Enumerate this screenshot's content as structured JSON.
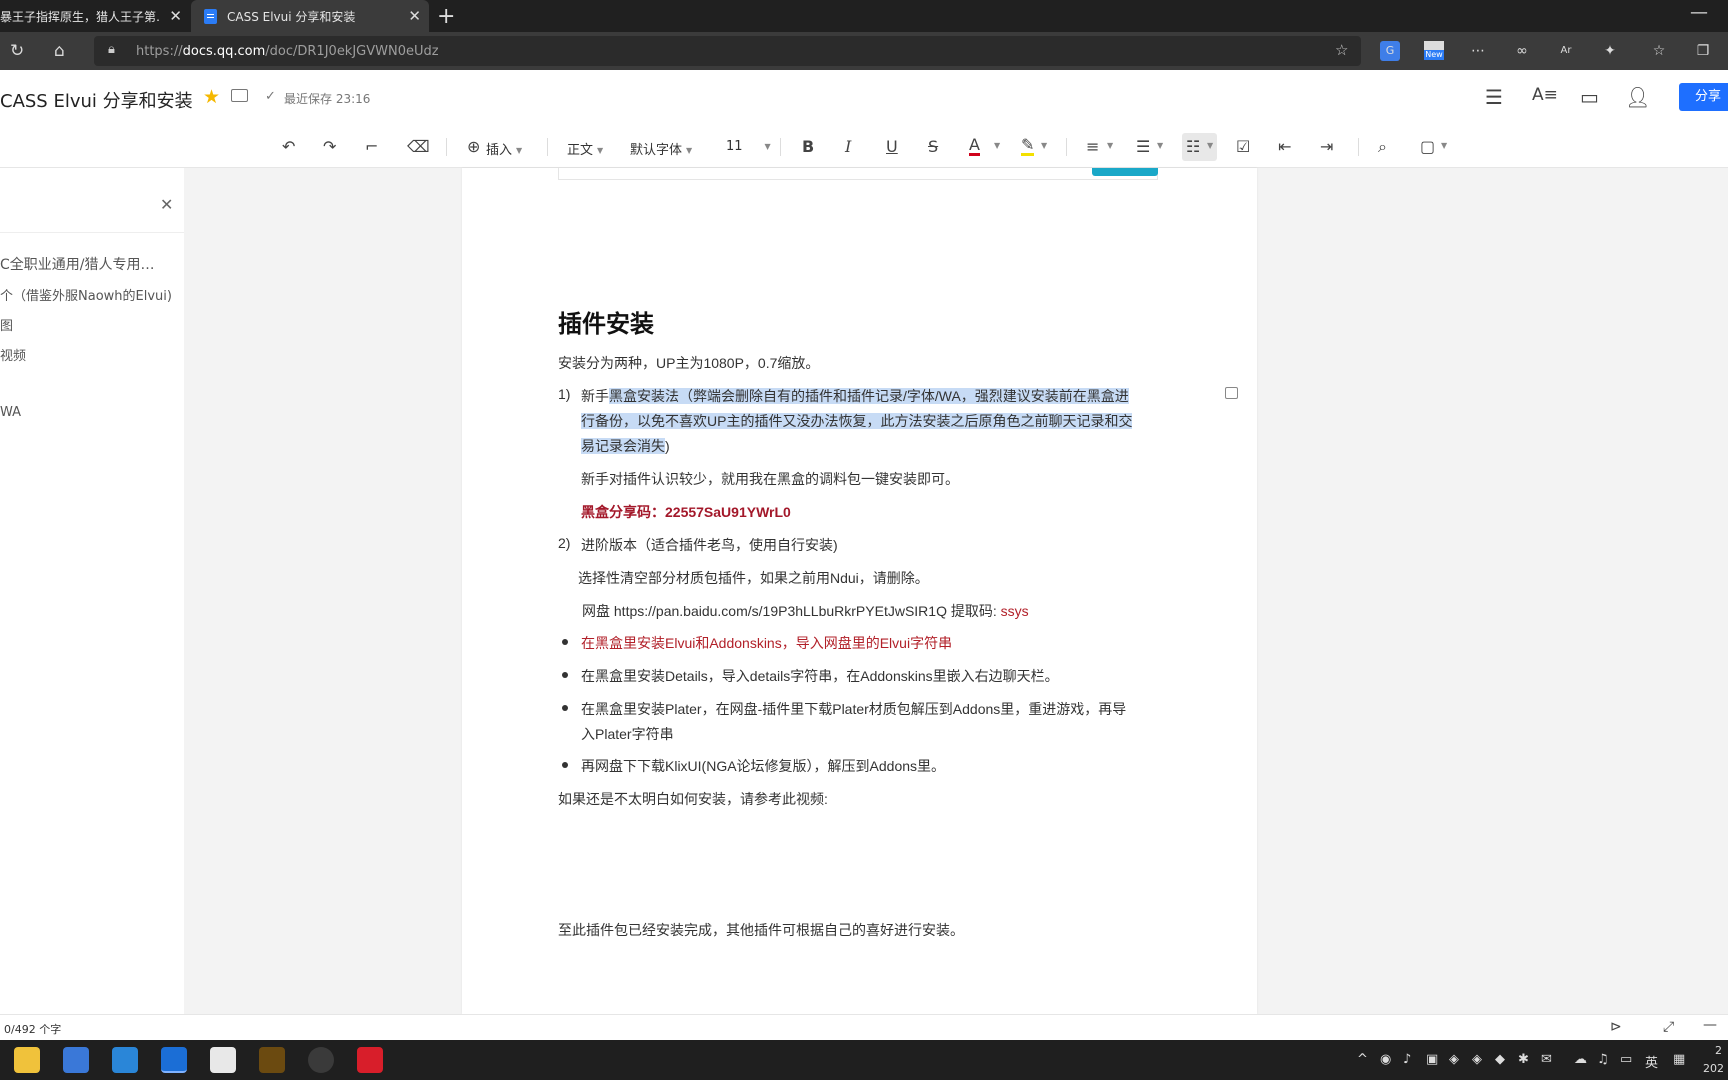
{
  "browser": {
    "tabs": [
      {
        "title": "暴王子指挥原生，猎人王子第…",
        "active": false
      },
      {
        "title": "CASS Elvui 分享和安装",
        "active": true
      }
    ],
    "url_prefix": "https://",
    "url_host": "docs.qq.com",
    "url_path": "/doc/DR1J0ekJGVWN0eUdz",
    "extensions": [
      "translate-icon",
      "new-badge-icon",
      "dots-icon",
      "infinity-icon",
      "ar-icon",
      "puzzle-icon",
      "favorites-icon",
      "collections-icon"
    ],
    "new_badge": "New"
  },
  "doc_header": {
    "title": "CASS Elvui 分享和安装",
    "save_status": "最近保存 23:16",
    "share_label": "分享"
  },
  "toolbar": {
    "insert": "插入",
    "style": "正文",
    "font": "默认字体",
    "size": "11"
  },
  "outline": {
    "items": [
      "C全职业通用/猎人专用…",
      "个（借鉴外服Naowh的Elvui)",
      "图",
      "视频",
      "WA"
    ]
  },
  "document": {
    "heading": "插件安装",
    "intro": "安装分为两种，UP主为1080P，0.7缩放。",
    "item1_num": "1)",
    "item1_lead": "新手",
    "item1_line1_hl": "黑盒安装法（弊端会删除自有的插件和插件记录/字体/WA，强烈建议安装前在黑盒进",
    "item1_line2_hl": "行备份，以免不喜欢UP主的插件又没办法恢复，此方法安装之后原角色之前聊天记录和交",
    "item1_line3_hl": "易记录会消失",
    "item1_line3_tail": ")",
    "newbie_note": "新手对插件认识较少，就用我在黑盒的调料包一键安装即可。",
    "share_code": "黑盒分享码：22557SaU91YWrL0",
    "item2_num": "2)",
    "item2": "进阶版本（适合插件老鸟，使用自行安装)",
    "select_note": "选择性清空部分材质包插件，如果之前用Ndui，请删除。",
    "netdisk_label": "网盘 https://pan.baidu.com/s/19P3hLLbuRkrPYEtJwSIR1Q 提取码: ",
    "netdisk_code": "ssys",
    "bullets": [
      "在黑盒里安装Elvui和Addonskins，导入网盘里的Elvui字符串",
      "在黑盒里安装Details，导入details字符串，在Addonskins里嵌入右边聊天栏。",
      "在黑盒里安装Plater，在网盘-插件里下载Plater材质包解压到Addons里，重进游戏，再导",
      "入Plater字符串",
      "再网盘下下载KlixUI(NGA论坛修复版），解压到Addons里。"
    ],
    "video_note": "如果还是不太明白如何安装，请参考此视频:",
    "closing": "至此插件包已经安装完成，其他插件可根据自己的喜好进行安装。"
  },
  "statusbar": {
    "word_count": "0/492 个字"
  },
  "taskbar": {
    "ime": "英",
    "clock_time": "2",
    "clock_date": "202"
  },
  "colors": {
    "accent": "#1e6fff",
    "highlight": "#c7dbf5",
    "red_text": "#b22029"
  }
}
